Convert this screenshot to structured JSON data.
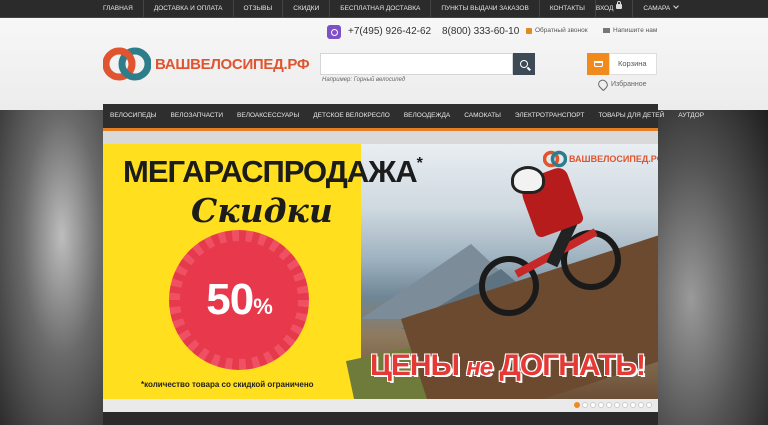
{
  "top_nav": {
    "items": [
      "Главная",
      "Доставка и оплата",
      "Отзывы",
      "Скидки",
      "Бесплатная доставка",
      "Пункты выдачи заказов",
      "Контакты"
    ],
    "login": "Вход",
    "city": "Самара"
  },
  "header": {
    "logo_text": "ВАШВЕЛОСИПЕД.РФ",
    "phone1": "+7(495) 926-42-62",
    "phone2": "8(800) 333-60-10",
    "callback": "Обратный звонок",
    "write_us": "Напишите нам",
    "search_placeholder": "",
    "search_hint": "Например: Горный велосипед",
    "cart_label": "Корзина",
    "favorites_label": "Избранное"
  },
  "main_nav": {
    "items": [
      "Велосипеды",
      "Велозапчасти",
      "Велоаксессуары",
      "Детское велокресло",
      "Велоодежда",
      "Самокаты",
      "Электротранспорт",
      "Товары для детей",
      "Аутдор"
    ]
  },
  "banner": {
    "title": "МЕГАРАСПРОДАЖА",
    "title_mark": "*",
    "subtitle": "Скидки",
    "discount_value": "50",
    "discount_unit": "%",
    "note": "*количество товара со скидкой ограничено",
    "slogan_part1": "ЦЕНЫ",
    "slogan_part2": "не",
    "slogan_part3": "ДОГНАТЬ!",
    "logo_text": "ВАШВЕЛОСИПЕД.РФ",
    "slide_count": 10,
    "active_slide": 1
  },
  "colors": {
    "accent": "#f08a1c",
    "brand_red": "#e0542f",
    "banner_yellow": "#ffdf1e",
    "badge_red": "#e8384b",
    "nav_dark": "#2e2e2e"
  }
}
